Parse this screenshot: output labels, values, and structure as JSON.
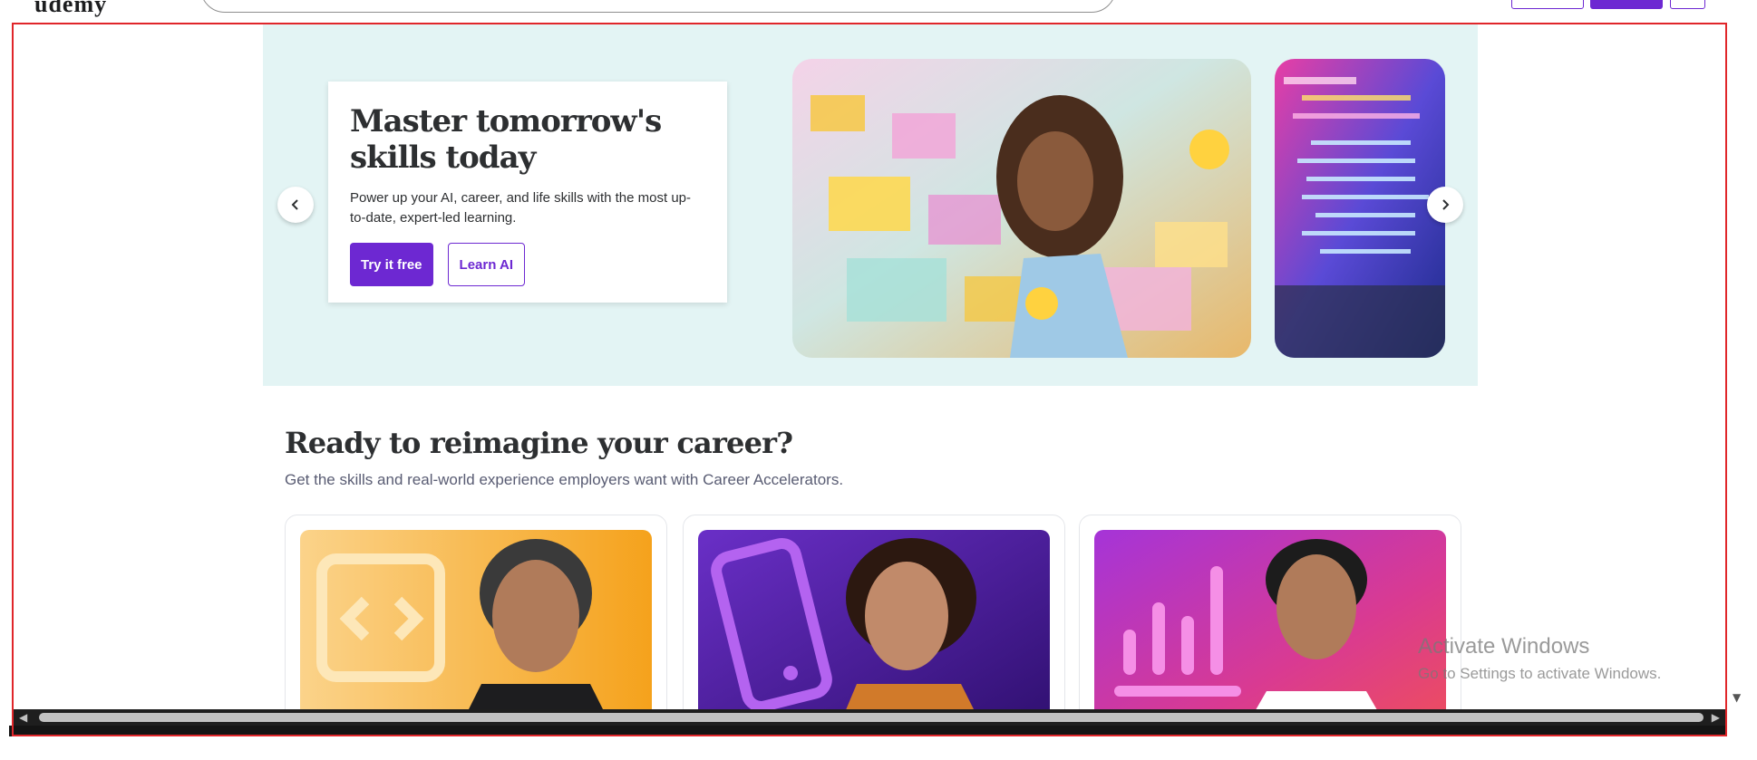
{
  "header": {
    "logo_text": "udemy"
  },
  "hero": {
    "title": "Master tomorrow's skills today",
    "subtitle": "Power up your AI, career, and life skills with the most up-to-date, expert-led learning.",
    "primary_cta": "Try it free",
    "secondary_cta": "Learn AI"
  },
  "career_section": {
    "title": "Ready to reimagine your career?",
    "subtitle": "Get the skills and real-world experience employers want with Career Accelerators.",
    "cards": [
      {
        "icon": "code-icon",
        "accent": "#f5a623"
      },
      {
        "icon": "phone-icon",
        "accent": "#5b21b6"
      },
      {
        "icon": "bar-chart-icon",
        "accent": "#c026d3"
      }
    ]
  },
  "watermark": {
    "title": "Activate Windows",
    "subtitle": "Go to Settings to activate Windows."
  },
  "colors": {
    "brand": "#6d28d2",
    "hero_bg": "#e3f4f4",
    "text": "#2d2f31",
    "muted": "#595c73"
  }
}
